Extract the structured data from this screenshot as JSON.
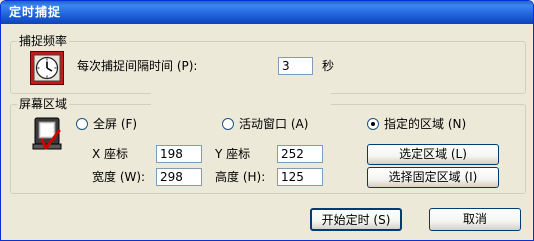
{
  "window": {
    "title": "定时捕捉"
  },
  "frequency_group": {
    "legend": "捕捉频率",
    "interval_label": "每次捕捉间隔时间 (P):",
    "interval_value": "3",
    "unit_label": "秒"
  },
  "area_group": {
    "legend": "屏幕区域",
    "radio_fullscreen": "全屏 (F)",
    "radio_active_window": "活动窗口 (A)",
    "radio_specified": "指定的区域 (N)",
    "selected_option": "specified",
    "x_label": "X 座标",
    "x_value": "198",
    "y_label": "Y 座标",
    "y_value": "252",
    "width_label": "宽度 (W):",
    "width_value": "298",
    "height_label": "高度 (H):",
    "height_value": "125",
    "select_region_button": "选定区域 (L)",
    "select_fixed_region_button": "选择固定区域 (I)"
  },
  "footer": {
    "start_button": "开始定时 (S)",
    "cancel_button": "取消"
  },
  "icons": {
    "clock": "clock-icon",
    "screen": "screen-capture-icon"
  }
}
